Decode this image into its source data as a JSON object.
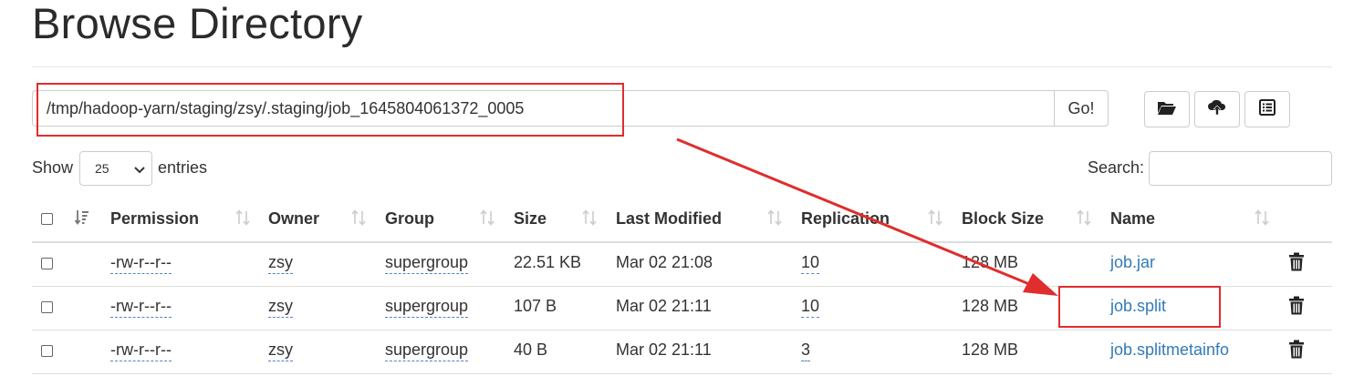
{
  "header": {
    "title": "Browse Directory"
  },
  "path_bar": {
    "value": "/tmp/hadoop-yarn/staging/zsy/.staging/job_1645804061372_0005",
    "go_label": "Go!"
  },
  "toolbar": {
    "buttons": [
      {
        "icon": "folder-open-icon"
      },
      {
        "icon": "cloud-upload-icon"
      },
      {
        "icon": "list-alt-icon"
      }
    ]
  },
  "table_controls": {
    "show_label": "Show",
    "entries_value": "25",
    "entries_label": "entries",
    "search_label": "Search:"
  },
  "table": {
    "columns": [
      "Permission",
      "Owner",
      "Group",
      "Size",
      "Last Modified",
      "Replication",
      "Block Size",
      "Name"
    ],
    "rows": [
      {
        "permission": "-rw-r--r--",
        "owner": "zsy",
        "group": "supergroup",
        "size": "22.51 KB",
        "modified": "Mar 02 21:08",
        "replication": "10",
        "block_size": "128 MB",
        "name": "job.jar"
      },
      {
        "permission": "-rw-r--r--",
        "owner": "zsy",
        "group": "supergroup",
        "size": "107 B",
        "modified": "Mar 02 21:11",
        "replication": "10",
        "block_size": "128 MB",
        "name": "job.split"
      },
      {
        "permission": "-rw-r--r--",
        "owner": "zsy",
        "group": "supergroup",
        "size": "40 B",
        "modified": "Mar 02 21:11",
        "replication": "3",
        "block_size": "128 MB",
        "name": "job.splitmetainfo"
      }
    ]
  },
  "annotation": {
    "color": "#e02d2d"
  }
}
